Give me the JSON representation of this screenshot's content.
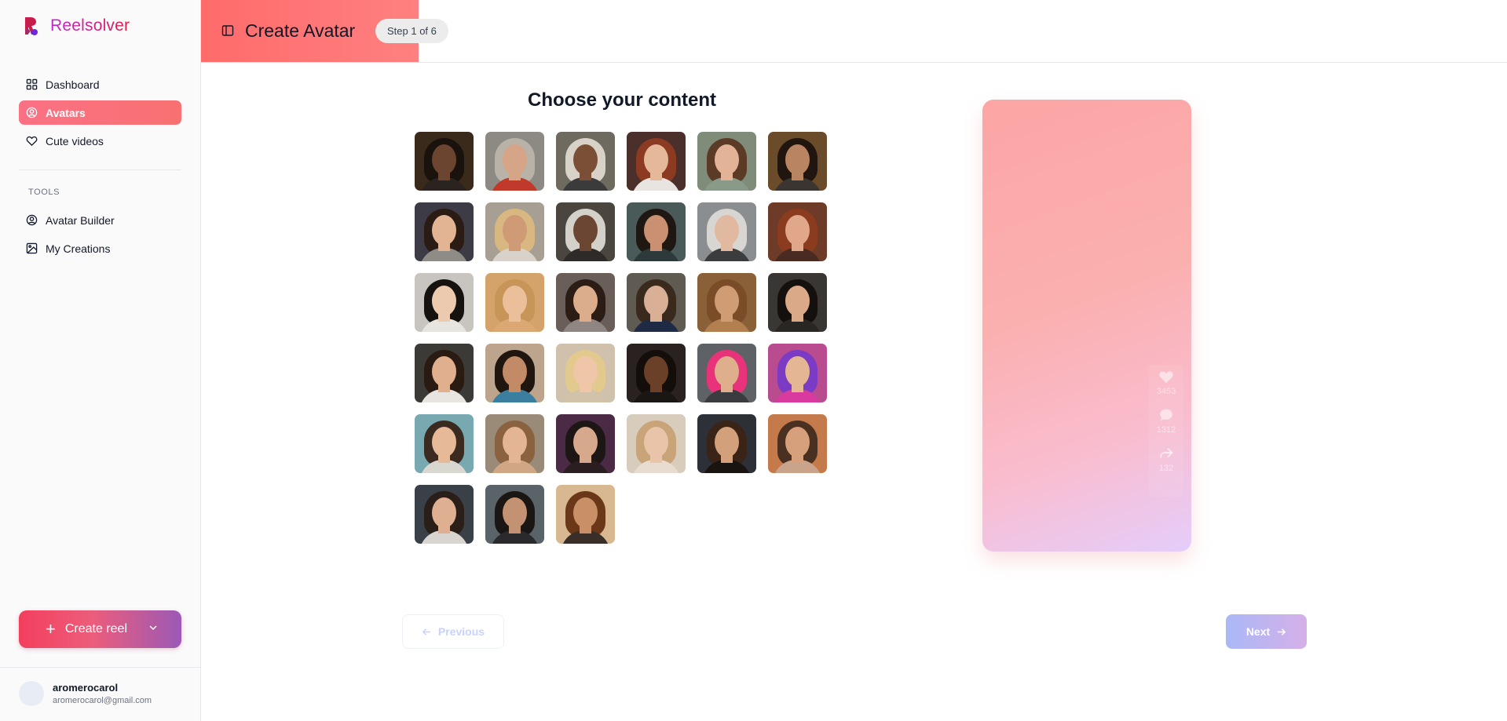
{
  "brand": {
    "name": "Reelsolver"
  },
  "sidebar": {
    "items": [
      {
        "label": "Dashboard",
        "icon": "grid-icon"
      },
      {
        "label": "Avatars",
        "icon": "user-circle-icon",
        "active": true
      },
      {
        "label": "Cute videos",
        "icon": "heart-icon"
      }
    ],
    "tools_heading": "TOOLS",
    "tools": [
      {
        "label": "Avatar Builder",
        "icon": "user-circle-icon"
      },
      {
        "label": "My Creations",
        "icon": "image-icon"
      }
    ],
    "create_label": "Create reel"
  },
  "user": {
    "name": "aromerocarol",
    "email": "aromerocarol@gmail.com"
  },
  "header": {
    "title": "Create Avatar",
    "step": "Step 1 of 6"
  },
  "main": {
    "title": "Choose your content"
  },
  "avatars": [
    {
      "skin": "#6b4530",
      "hair": "#1a120c",
      "shirt": "#2b2320",
      "bg": "#3a2a1c"
    },
    {
      "skin": "#d6a486",
      "hair": "#b8b2a8",
      "shirt": "#c0392b",
      "bg": "#8c8a82"
    },
    {
      "skin": "#7a4f36",
      "hair": "#d9d2c8",
      "shirt": "#3b3b3b",
      "bg": "#6f6a60"
    },
    {
      "skin": "#e6b89a",
      "hair": "#8c3a22",
      "shirt": "#e8e4e0",
      "bg": "#4a2f2a"
    },
    {
      "skin": "#e2b396",
      "hair": "#5b3a26",
      "shirt": "#8a9a88",
      "bg": "#7f8c7a"
    },
    {
      "skin": "#b98462",
      "hair": "#20160f",
      "shirt": "#3a3530",
      "bg": "#6b4c2a"
    },
    {
      "skin": "#e2b493",
      "hair": "#2a1b14",
      "shirt": "#8f8b86",
      "bg": "#3d3b46"
    },
    {
      "skin": "#cf9a76",
      "hair": "#d8b880",
      "shirt": "#d8d2ca",
      "bg": "#a79f93"
    },
    {
      "skin": "#6b4733",
      "hair": "#d4d0ca",
      "shirt": "#2e2a28",
      "bg": "#4a463f"
    },
    {
      "skin": "#c99172",
      "hair": "#1e1712",
      "shirt": "#2c3a3c",
      "bg": "#4a5a58"
    },
    {
      "skin": "#e0b9a0",
      "hair": "#d8d6d2",
      "shirt": "#3a3c3e",
      "bg": "#8a8e90"
    },
    {
      "skin": "#e0a78a",
      "hair": "#8b3b1e",
      "shirt": "#4a2b22",
      "bg": "#6e3b28"
    },
    {
      "skin": "#eccab0",
      "hair": "#151210",
      "shirt": "#e8e4e0",
      "bg": "#c8c4c0"
    },
    {
      "skin": "#ebbf9a",
      "hair": "#c89558",
      "shirt": "#d9a873",
      "bg": "#d4a36c"
    },
    {
      "skin": "#dcad8c",
      "hair": "#2b1c16",
      "shirt": "#8f8682",
      "bg": "#6a5e59"
    },
    {
      "skin": "#d9b096",
      "hair": "#3a2a1e",
      "shirt": "#1f2a44",
      "bg": "#5f5a52"
    },
    {
      "skin": "#cf9c74",
      "hair": "#7a4c28",
      "shirt": "#b47f4e",
      "bg": "#8a6038"
    },
    {
      "skin": "#d9a988",
      "hair": "#14100e",
      "shirt": "#2a2624",
      "bg": "#3a3634"
    },
    {
      "skin": "#e0b08e",
      "hair": "#2a1b12",
      "shirt": "#e8e4e0",
      "bg": "#3b3a36"
    },
    {
      "skin": "#c28a66",
      "hair": "#1f1610",
      "shirt": "#3a7fa0",
      "bg": "#bda48c"
    },
    {
      "skin": "#efc7a8",
      "hair": "#e2c98e",
      "shirt": "#d2c2aa",
      "bg": "#cfc1ab"
    },
    {
      "skin": "#6a4028",
      "hair": "#140e0a",
      "shirt": "#1a1614",
      "bg": "#2a2220"
    },
    {
      "skin": "#dfae8c",
      "hair": "#e8327a",
      "shirt": "#3a3c40",
      "bg": "#5e6266"
    },
    {
      "skin": "#e4b694",
      "hair": "#7c3bc4",
      "shirt": "#d93a9e",
      "bg": "#b84c8e"
    },
    {
      "skin": "#e6b998",
      "hair": "#3a2a20",
      "shirt": "#d8d8d0",
      "bg": "#78a8b0"
    },
    {
      "skin": "#e3b594",
      "hair": "#8a6240",
      "shirt": "#cfa784",
      "bg": "#9a8a78"
    },
    {
      "skin": "#d6a88c",
      "hair": "#1c1614",
      "shirt": "#2a1e20",
      "bg": "#4a2a44"
    },
    {
      "skin": "#eac4a8",
      "hair": "#c8a478",
      "shirt": "#e8dcd0",
      "bg": "#d8ccbc"
    },
    {
      "skin": "#d3a07c",
      "hair": "#3a2418",
      "shirt": "#1a1410",
      "bg": "#2e3038"
    },
    {
      "skin": "#d6a07c",
      "hair": "#4a3020",
      "shirt": "#c9a48a",
      "bg": "#c47a4a"
    },
    {
      "skin": "#deb091",
      "hair": "#2a1e18",
      "shirt": "#d8d4d0",
      "bg": "#3a4048"
    },
    {
      "skin": "#c39272",
      "hair": "#1a1614",
      "shirt": "#2a2a2c",
      "bg": "#5a6468"
    },
    {
      "skin": "#c98f66",
      "hair": "#6a3818",
      "shirt": "#3a2e28",
      "bg": "#d8b890"
    }
  ],
  "preview": {
    "likes": "3453",
    "comments": "1312",
    "shares": "132"
  },
  "nav_buttons": {
    "previous": "Previous",
    "next": "Next"
  },
  "colors": {
    "accent": "#f87171",
    "brand_gradient_start": "#c026d3",
    "brand_gradient_end": "#e11d48",
    "next_gradient_start": "#aab8f7",
    "next_gradient_end": "#d6b0e8"
  }
}
